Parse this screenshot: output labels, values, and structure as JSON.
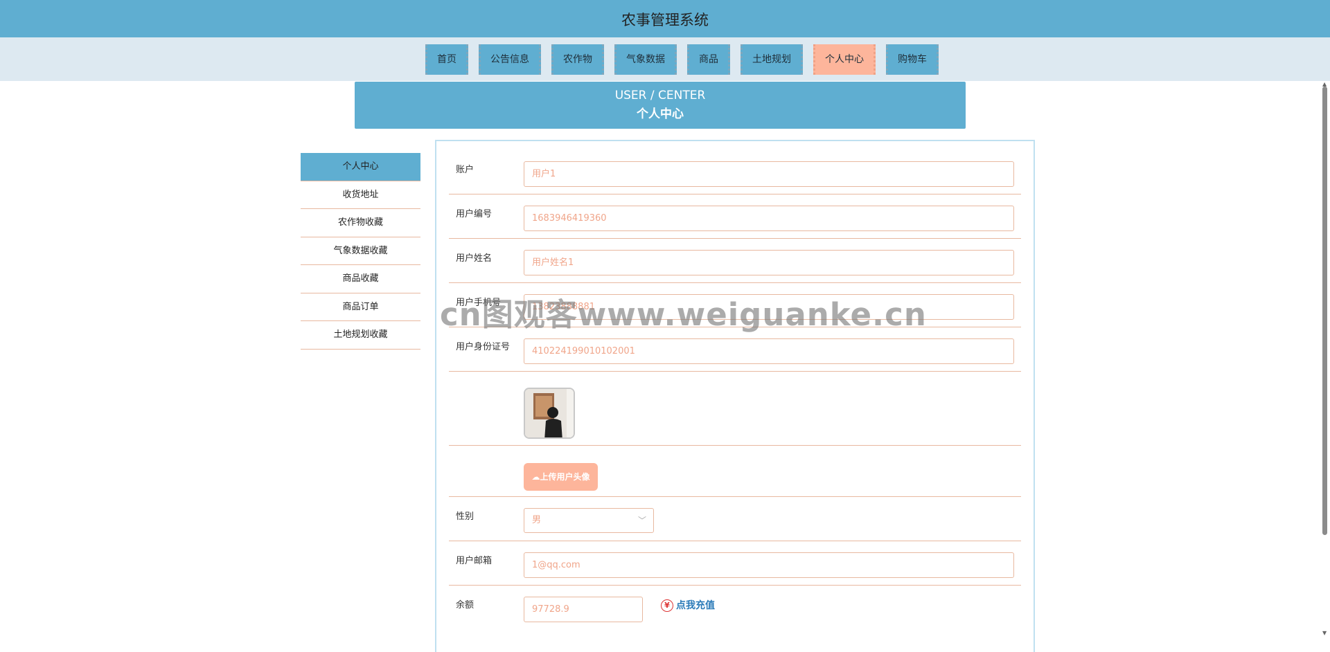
{
  "app": {
    "title": "农事管理系统"
  },
  "nav": {
    "items": [
      {
        "label": "首页"
      },
      {
        "label": "公告信息"
      },
      {
        "label": "农作物"
      },
      {
        "label": "气象数据"
      },
      {
        "label": "商品"
      },
      {
        "label": "土地规划"
      },
      {
        "label": "个人中心"
      },
      {
        "label": "购物车"
      }
    ],
    "active": "个人中心"
  },
  "banner": {
    "en": "USER / CENTER",
    "cn": "个人中心"
  },
  "sidebar": {
    "items": [
      {
        "label": "个人中心"
      },
      {
        "label": "收货地址"
      },
      {
        "label": "农作物收藏"
      },
      {
        "label": "气象数据收藏"
      },
      {
        "label": "商品收藏"
      },
      {
        "label": "商品订单"
      },
      {
        "label": "土地规划收藏"
      }
    ]
  },
  "form": {
    "account": {
      "label": "账户",
      "value": "用户1"
    },
    "user_no": {
      "label": "用户编号",
      "value": "1683946419360"
    },
    "user_name": {
      "label": "用户姓名",
      "value": "用户姓名1"
    },
    "phone": {
      "label": "用户手机号",
      "value": "13823888881"
    },
    "id_card": {
      "label": "用户身份证号",
      "value": "410224199010102001"
    },
    "upload_label": "上传用户头像",
    "gender": {
      "label": "性别",
      "value": "男"
    },
    "email": {
      "label": "用户邮箱",
      "value": "1@qq.com"
    },
    "balance": {
      "label": "余额",
      "value": "97728.9",
      "recharge": "点我充值",
      "currency_symbol": "¥"
    }
  },
  "watermark": "cn图观客www.weiguanke.cn",
  "colors": {
    "primary": "#5faed1",
    "accent": "#fdb59b",
    "border": "#e8b89f",
    "link": "#2a7ab8"
  }
}
